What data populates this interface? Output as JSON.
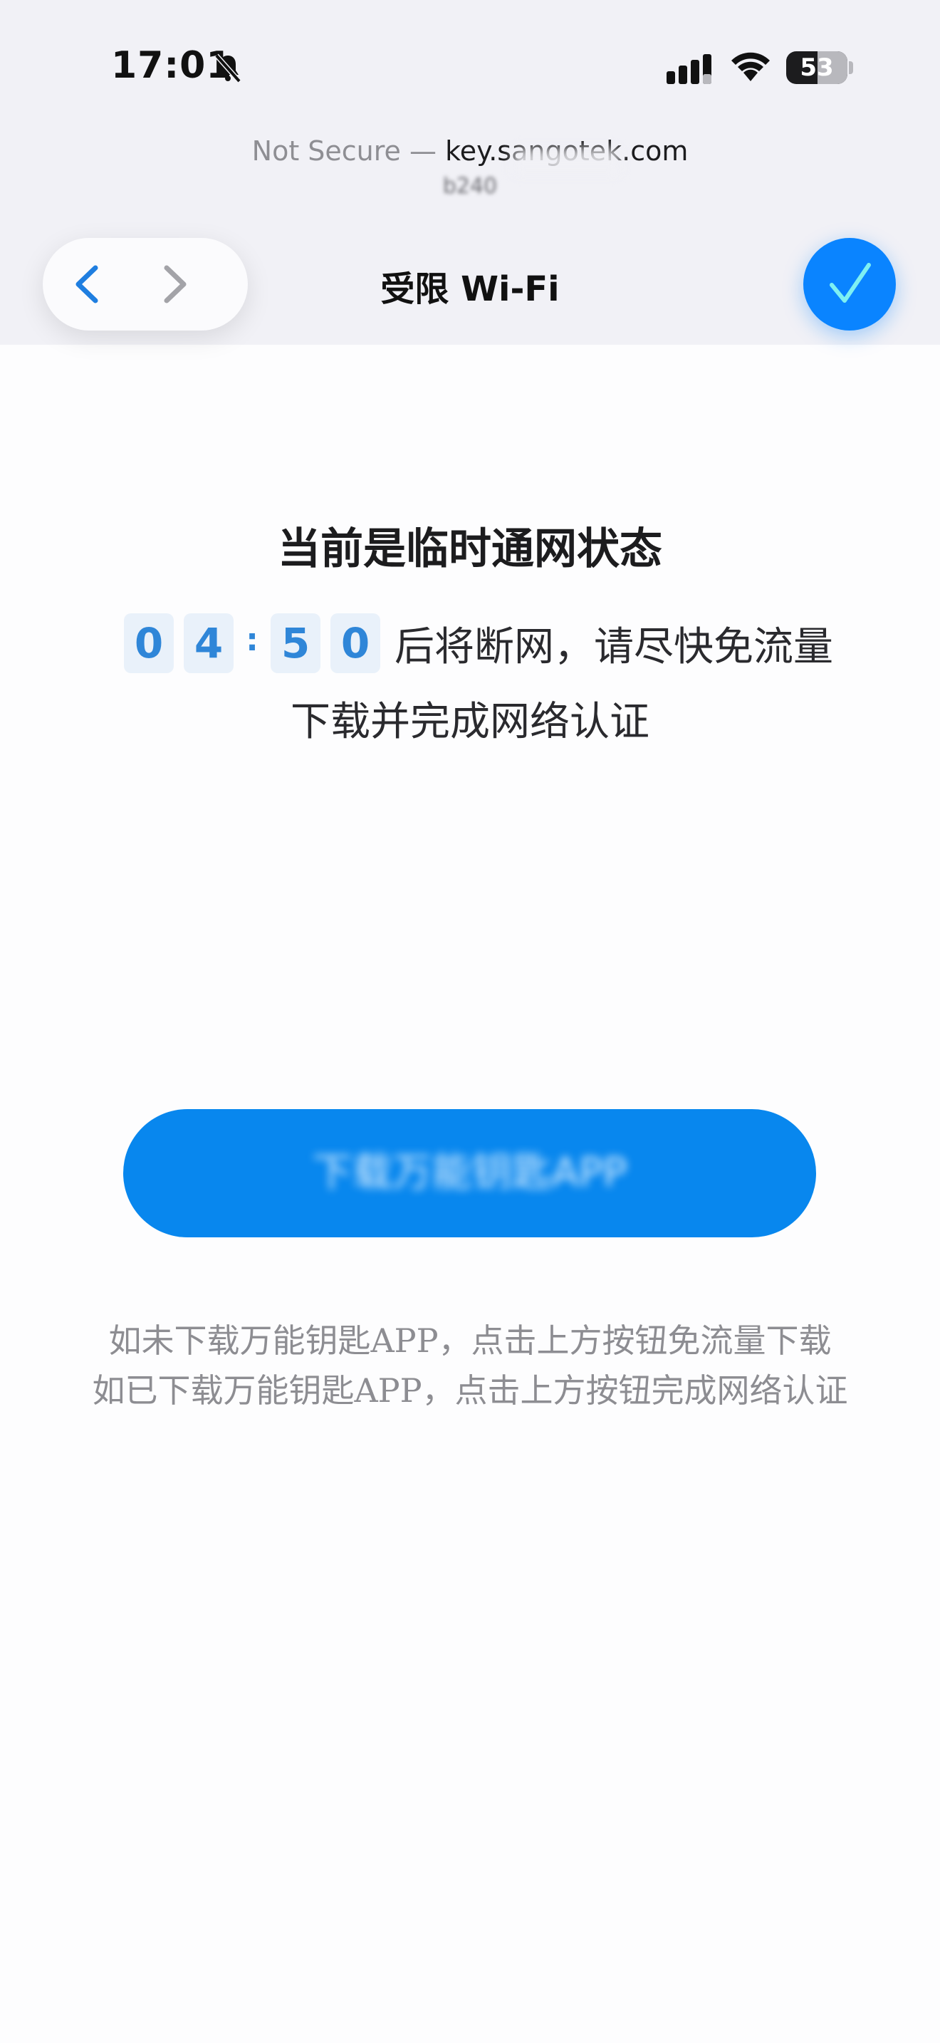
{
  "status_bar": {
    "time": "17:01",
    "battery": "53"
  },
  "browser": {
    "url_prefix": "Not Secure — ",
    "url_host": "key.sangotek.com",
    "url_sub": "b240"
  },
  "nav": {
    "title": "受限 Wi-Fi"
  },
  "content": {
    "headline": "当前是临时通网状态",
    "countdown": {
      "d1": "0",
      "d2": "4",
      "separator": ":",
      "d3": "5",
      "d4": "0"
    },
    "countdown_suffix": "后将断网，请尽快免流量",
    "line2": "下载并完成网络认证",
    "button_label": "下载万能钥匙APP",
    "hint1": "如未下载万能钥匙APP，点击上方按钮免流量下载",
    "hint2": "如已下载万能钥匙APP，点击上方按钮完成网络认证"
  },
  "colors": {
    "accent": "#0887ee",
    "done_button": "#0a84ff",
    "digit_bg": "#e9f1fa",
    "digit_text": "#2f86d8"
  }
}
